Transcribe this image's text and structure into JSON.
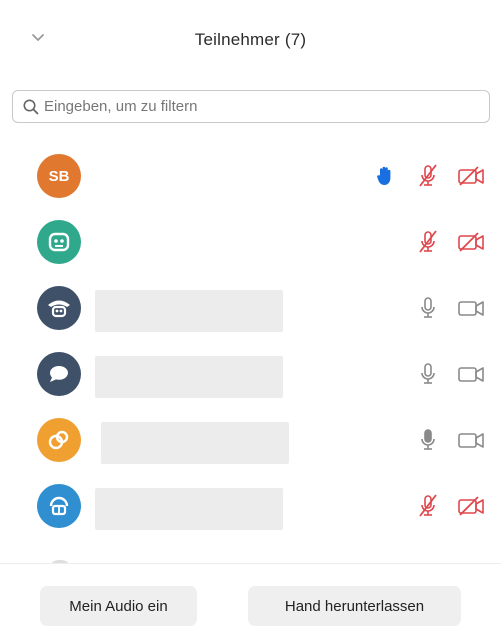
{
  "header": {
    "title": "Teilnehmer (7)",
    "collapse_icon": "chevron-down-icon"
  },
  "search": {
    "placeholder": "Eingeben, um zu filtern",
    "value": "",
    "icon": "search-icon"
  },
  "colors": {
    "muted_red": "#e0474c",
    "raised_hand_blue": "#1a6fe0",
    "icon_gray": "#8a8a8a",
    "name_placeholder": "#ececec"
  },
  "participants": [
    {
      "initials": "SB",
      "avatar_color": "#e07830",
      "avatar_icon": "",
      "hand_raised": true,
      "mic": "muted",
      "video": "off",
      "name_visible": false
    },
    {
      "initials": "",
      "avatar_color": "#2fa88c",
      "avatar_icon": "face-icon",
      "hand_raised": false,
      "mic": "muted",
      "video": "off",
      "name_visible": false
    },
    {
      "initials": "",
      "avatar_color": "#3f5168",
      "avatar_icon": "face-icon",
      "hand_raised": false,
      "mic": "on",
      "video": "off-gray",
      "name_visible": false
    },
    {
      "initials": "",
      "avatar_color": "#3f5168",
      "avatar_icon": "chat-bubble-icon",
      "hand_raised": false,
      "mic": "on",
      "video": "off-gray",
      "name_visible": false
    },
    {
      "initials": "",
      "avatar_color": "#f0a030",
      "avatar_icon": "face-icon",
      "hand_raised": false,
      "mic": "speaking",
      "video": "off-gray",
      "name_visible": false
    },
    {
      "initials": "",
      "avatar_color": "#2f8fd0",
      "avatar_icon": "face-icon",
      "hand_raised": false,
      "mic": "muted",
      "video": "off",
      "name_visible": false
    }
  ],
  "footer": {
    "audio_button": "Mein Audio ein",
    "hand_button": "Hand herunterlassen"
  }
}
